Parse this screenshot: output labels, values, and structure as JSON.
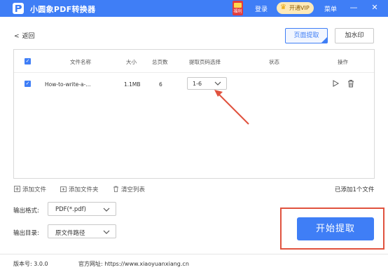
{
  "titlebar": {
    "app_name": "小圆象PDF转换器",
    "gift_label": "福利",
    "login": "登录",
    "vip": "开通VIP",
    "menu": "菜单",
    "minimize": "—",
    "close": "✕"
  },
  "nav": {
    "back": "返回",
    "mode_extract": "页面提取",
    "mode_watermark": "加水印"
  },
  "table": {
    "headers": {
      "filename": "文件名称",
      "size": "大小",
      "pages": "总页数",
      "range": "提取页码选择",
      "status": "状态",
      "actions": "操作"
    },
    "rows": [
      {
        "filename": "How-to-write-a-...",
        "size": "1.1MB",
        "pages": "6",
        "range": "1-6",
        "status": ""
      }
    ]
  },
  "toolbar": {
    "add_file": "添加文件",
    "add_folder": "添加文件夹",
    "clear_list": "清空列表",
    "added_count": "已添加1个文件"
  },
  "output": {
    "format_label": "输出格式:",
    "format_value": "PDF(*.pdf)",
    "dir_label": "输出目录:",
    "dir_value": "原文件路径"
  },
  "start_button": "开始提取",
  "statusbar": {
    "version": "版本号: 3.0.0",
    "website": "官方网址: https://www.xiaoyuanxiang.cn"
  },
  "colors": {
    "accent": "#3f7ef6",
    "highlight": "#e0523e",
    "vip_bg": "#fde9b8"
  }
}
